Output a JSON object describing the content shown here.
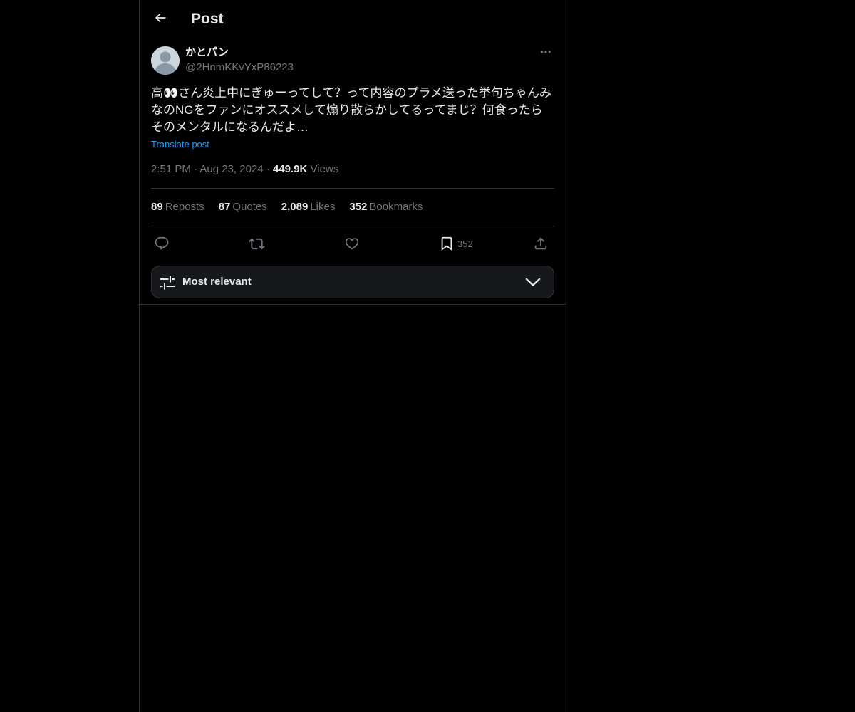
{
  "header": {
    "title": "Post",
    "back_icon": "arrow-left-icon"
  },
  "author": {
    "display_name": "かとパン",
    "handle": "@2HnmKKvYxP86223",
    "avatar_icon": "default-avatar-icon",
    "more_icon": "ellipsis-icon"
  },
  "post": {
    "text": "高👀さん炎上中にぎゅーってして？って内容のプラメ送った挙句ちゃんみなのNGをファンにオススメして煽り散らかしてるってまじ？何食ったらそのメンタルになるんだよ…",
    "translate_label": "Translate post",
    "time": "2:51 PM",
    "separator": "·",
    "date": "Aug 23, 2024",
    "views_count": "449.9K",
    "views_label": "Views"
  },
  "stats": [
    {
      "count": "89",
      "label": "Reposts"
    },
    {
      "count": "87",
      "label": "Quotes"
    },
    {
      "count": "2,089",
      "label": "Likes"
    },
    {
      "count": "352",
      "label": "Bookmarks"
    }
  ],
  "actions": {
    "reply_icon": "reply-icon",
    "repost_icon": "repost-icon",
    "like_icon": "heart-icon",
    "bookmark_icon": "bookmark-icon",
    "bookmark_count": "352",
    "share_icon": "share-icon"
  },
  "sort": {
    "label": "Most relevant",
    "icon": "sliders-icon",
    "chevron_icon": "chevron-down-icon"
  },
  "colors": {
    "background": "#000000",
    "text_primary": "#e7e9ea",
    "text_secondary": "#71767b",
    "accent": "#1d9bf0",
    "border": "#2f3336",
    "sort_bar_bg": "#16181c"
  }
}
